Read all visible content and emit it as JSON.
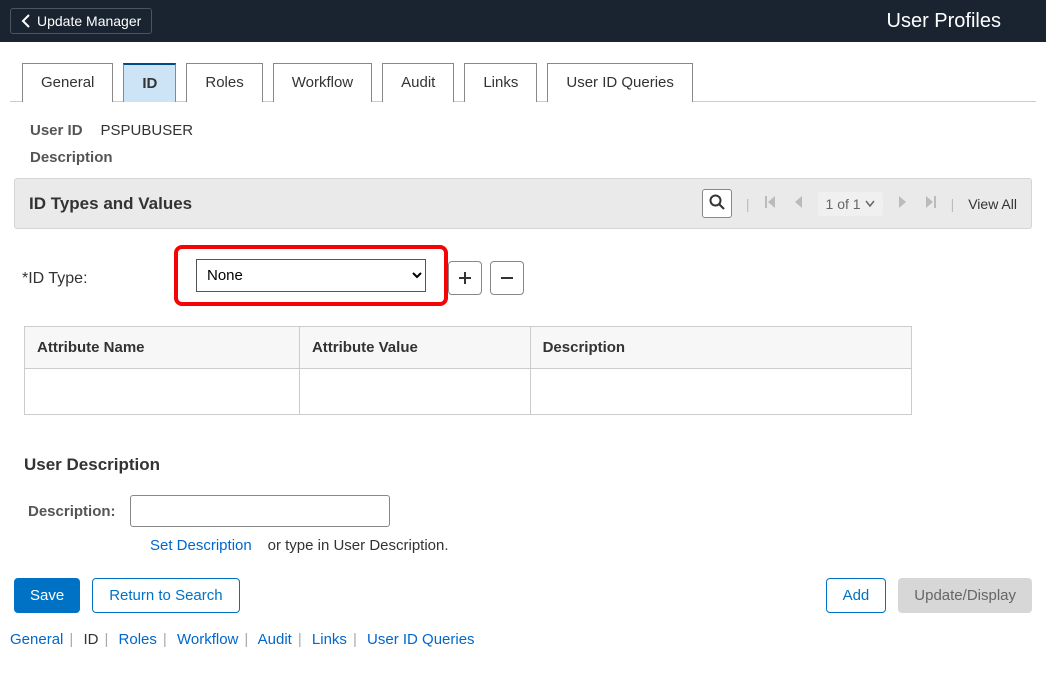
{
  "topbar": {
    "back_label": "Update Manager",
    "page_title": "User Profiles"
  },
  "tabs": {
    "general": "General",
    "id": "ID",
    "roles": "Roles",
    "workflow": "Workflow",
    "audit": "Audit",
    "links": "Links",
    "userid_queries": "User ID Queries"
  },
  "fields": {
    "user_id_label": "User ID",
    "user_id_value": "PSPUBUSER",
    "description_label": "Description"
  },
  "scroll_header": {
    "title": "ID Types and Values",
    "page_text": "1 of 1",
    "view_all": "View All"
  },
  "id_type": {
    "label": "*ID Type:",
    "value": "None",
    "options": [
      "None"
    ]
  },
  "attr_table": {
    "col1": "Attribute Name",
    "col2": "Attribute Value",
    "col3": "Description"
  },
  "user_desc": {
    "heading": "User Description",
    "label": "Description:",
    "set_description": "Set Description",
    "or_type": "or type in User Description."
  },
  "buttons": {
    "save": "Save",
    "return": "Return to Search",
    "add": "Add",
    "update": "Update/Display"
  },
  "footer_links": {
    "general": "General",
    "id": "ID",
    "roles": "Roles",
    "workflow": "Workflow",
    "audit": "Audit",
    "links": "Links",
    "userid_queries": "User ID Queries"
  }
}
